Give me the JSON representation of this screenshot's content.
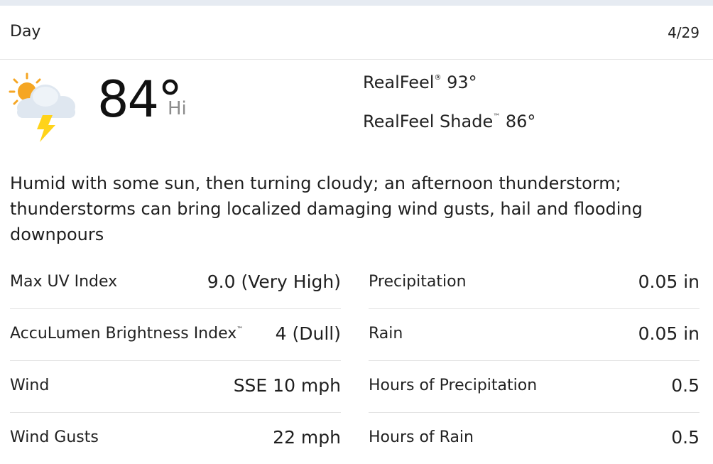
{
  "header": {
    "label": "Day",
    "date": "4/29"
  },
  "current": {
    "icon": "thunderstorm-partly-sunny-icon",
    "temperature": "84°",
    "hi_label": "Hi",
    "realfeel_label": "RealFeel",
    "realfeel_mark": "®",
    "realfeel_value": "93°",
    "realfeel_shade_label": "RealFeel Shade",
    "realfeel_shade_mark": "™",
    "realfeel_shade_value": "86°"
  },
  "phrase": "Humid with some sun, then turning cloudy; an afternoon thunderstorm; thunderstorms can bring localized damaging wind gusts, hail and flooding downpours",
  "details_left": [
    {
      "label": "Max UV Index",
      "value": "9.0 (Very High)"
    },
    {
      "label": "AccuLumen Brightness Index",
      "mark": "™",
      "value": "4 (Dull)"
    },
    {
      "label": "Wind",
      "value": "SSE 10 mph"
    },
    {
      "label": "Wind Gusts",
      "value": "22 mph"
    }
  ],
  "details_right": [
    {
      "label": "Precipitation",
      "value": "0.05 in"
    },
    {
      "label": "Rain",
      "value": "0.05 in"
    },
    {
      "label": "Hours of Precipitation",
      "value": "0.5"
    },
    {
      "label": "Hours of Rain",
      "value": "0.5"
    }
  ],
  "colors": {
    "sun": "#f5a623",
    "cloud": "#dfe7f0",
    "bolt": "#ffd31a",
    "divider": "#e3e3e3"
  }
}
